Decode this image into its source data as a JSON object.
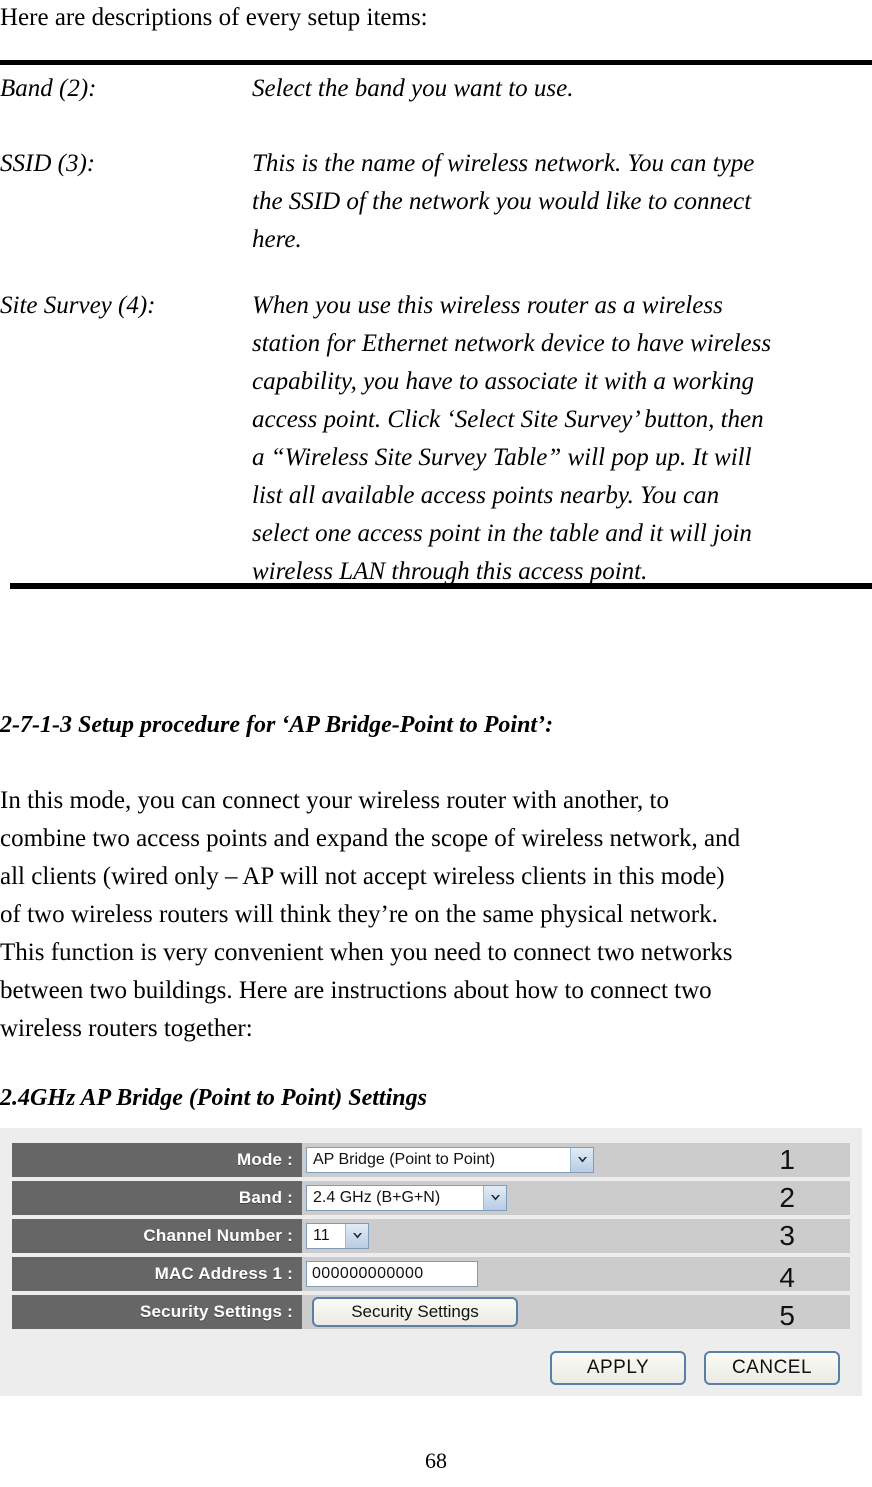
{
  "intro": {
    "text": "Here are descriptions of every setup items:"
  },
  "definitions": [
    {
      "term": "Band (2):",
      "lines": [
        "Select the band you want to use."
      ]
    },
    {
      "term": "SSID (3):",
      "lines": [
        "This is the name of wireless network. You can type",
        "the SSID of the network you would like to connect",
        "here."
      ]
    },
    {
      "term": "Site Survey (4):",
      "lines": [
        "When you use this wireless router as a wireless",
        "station for Ethernet network device to have wireless",
        "capability, you have to associate it with a working",
        "access point. Click ‘Select Site Survey’ button, then",
        "a “Wireless Site Survey Table” will pop up. It will",
        "list all available access points nearby. You can",
        "select one access point in the table and it will join",
        "wireless LAN through this access point."
      ]
    }
  ],
  "section": {
    "heading": "2-7-1-3 Setup procedure for ‘AP Bridge-Point to Point’:",
    "paragraph_lines": [
      "In this mode, you can connect your wireless router with another, to",
      "combine two access points and expand the scope of wireless network, and",
      "all clients (wired only – AP will not accept wireless clients in this mode)",
      "of two wireless routers will think they’re on the same physical network.",
      "This function is very convenient when you need to connect two networks",
      "between two buildings. Here are instructions about how to connect two",
      "wireless routers together:"
    ],
    "subheading": "2.4GHz AP Bridge (Point to Point) Settings"
  },
  "settings_panel": {
    "rows": [
      {
        "label": "Mode :",
        "control": "select",
        "value": "AP Bridge (Point to Point)",
        "number": "1"
      },
      {
        "label": "Band :",
        "control": "select",
        "value": "2.4 GHz (B+G+N)",
        "number": "2"
      },
      {
        "label": "Channel Number :",
        "control": "select",
        "value": "11",
        "number": "3"
      },
      {
        "label": "MAC Address 1 :",
        "control": "text",
        "value": "000000000000",
        "number": "4"
      },
      {
        "label": "Security Settings :",
        "control": "button",
        "value": "Security Settings",
        "number": "5"
      }
    ],
    "actions": {
      "apply_label": "APPLY",
      "cancel_label": "CANCEL"
    },
    "colors": {
      "label_bg": "#666666",
      "value_bg": "#cccccc",
      "panel_bg": "#ededed",
      "input_border": "#7f9db9",
      "arrow_bg": "#b8cce4",
      "button_border": "#5a7fa6"
    },
    "icons": {
      "dropdown": "chevron-down-icon"
    }
  },
  "footer": {
    "page_number": "68"
  }
}
